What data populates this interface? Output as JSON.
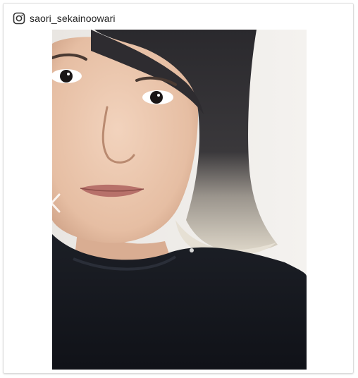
{
  "post": {
    "username": "saori_sekainoowari",
    "platform_icon": "instagram-icon",
    "nav_icon": "chevron-left-icon"
  },
  "colors": {
    "card_border": "#dcdcdc",
    "text": "#222222",
    "photo_wall": "#efece8",
    "hair": "#2b2a2e",
    "shirt": "#15171c",
    "skin": "#e8c3a9"
  }
}
